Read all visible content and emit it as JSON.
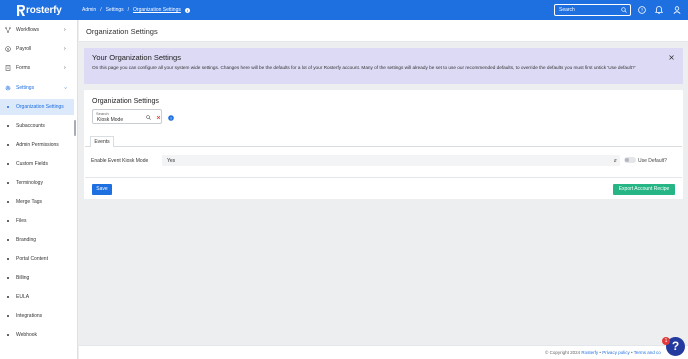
{
  "app": {
    "logo_text": "rosterfy",
    "brand_color": "#1e6fe0",
    "accent_green": "#26b685"
  },
  "header": {
    "breadcrumbs": [
      "Admin",
      "Settings",
      "Organization Settings"
    ],
    "separator": "/",
    "search_placeholder": "Search",
    "icons": [
      "info-icon",
      "search-icon",
      "help-circle-icon",
      "bell-icon",
      "user-icon"
    ]
  },
  "sidebar": {
    "items": [
      {
        "label": "Workflows",
        "icon": "workflow-icon"
      },
      {
        "label": "Payroll",
        "icon": "payroll-icon"
      },
      {
        "label": "Forms",
        "icon": "forms-icon"
      },
      {
        "label": "Settings",
        "icon": "gear-icon"
      }
    ],
    "sub_items": [
      "Organization Settings",
      "Subaccounts",
      "Admin Permissions",
      "Custom Fields",
      "Terminology",
      "Merge Tags",
      "Files",
      "Branding",
      "Portal Content",
      "Billing",
      "EULA",
      "Integrations",
      "Webhook"
    ],
    "active_sub": "Organization Settings"
  },
  "page": {
    "title": "Organization Settings"
  },
  "banner": {
    "title": "Your Organization Settings",
    "body": "On this page you can configure all your system wide settings. Changes here will be the defaults for a lot of your Rosterfy account. Many of the settings will already be set to use our recommended defaults, to override the defaults you must first untick 'Use default?'"
  },
  "settings_card": {
    "title": "Organization Settings",
    "search_label": "Search",
    "search_value": "Kiosk Mode",
    "tab": "Events",
    "row_label": "Enable Event Kiosk Mode",
    "row_value": "Yes",
    "use_default_label": "Use Default?",
    "save_label": "Save",
    "export_label": "Export Account Recipe"
  },
  "footer": {
    "copyright": "© Copyright 2024 ",
    "brand_link": "Rosterfy",
    "sep": " • ",
    "privacy": "Privacy policy",
    "terms": "Terms and co"
  },
  "help": {
    "label": "?",
    "badge": "1"
  }
}
